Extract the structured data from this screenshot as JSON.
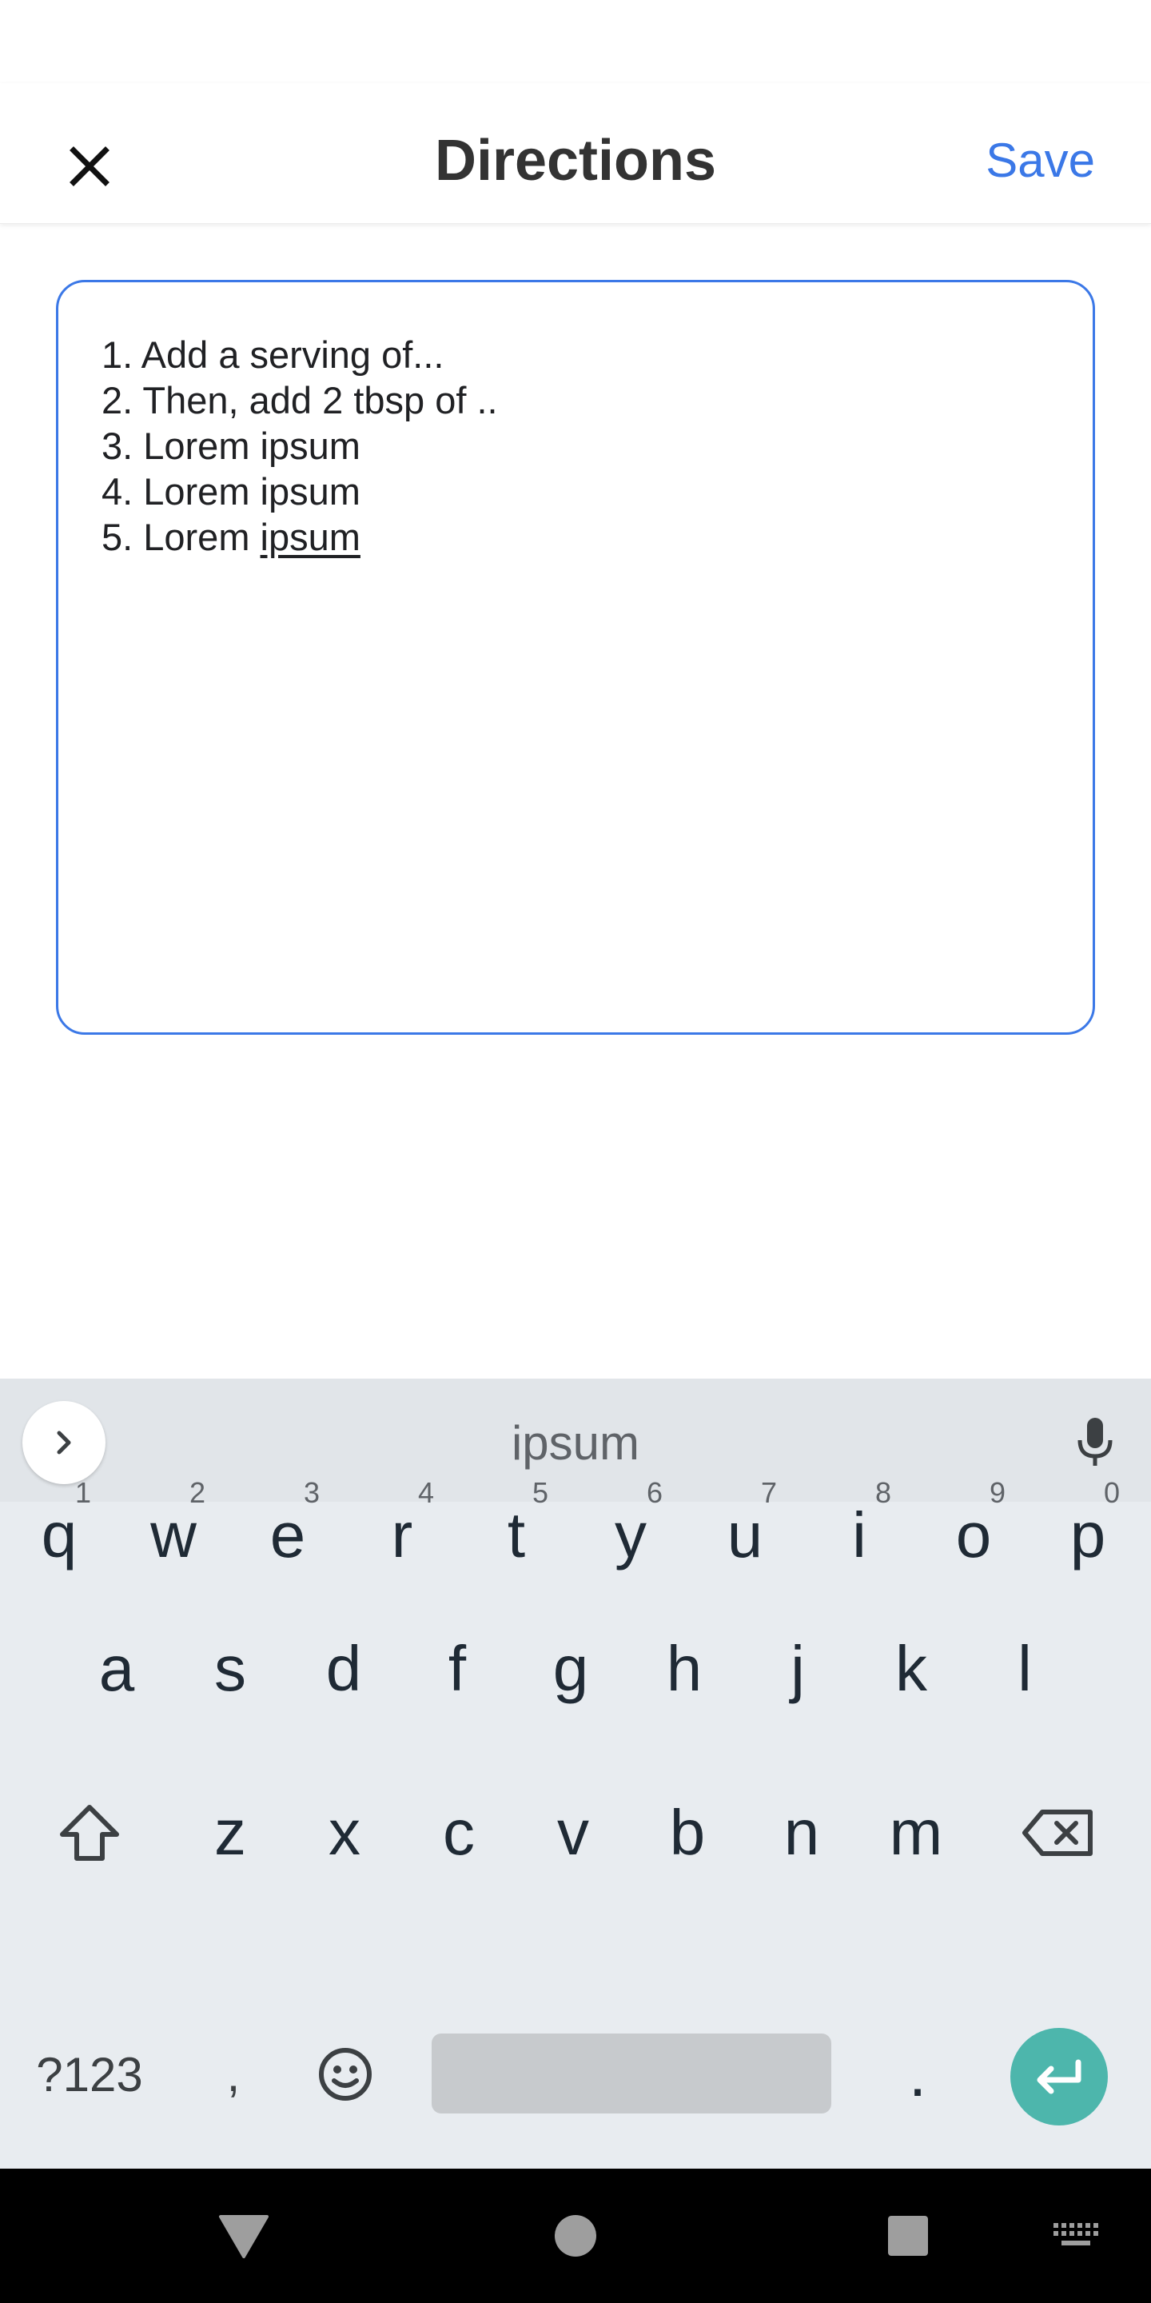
{
  "app_bar": {
    "title": "Directions",
    "save_label": "Save",
    "close_icon": "close-icon"
  },
  "editor": {
    "lines": [
      "1. Add a serving of...",
      "2. Then, add 2 tbsp of ..",
      "3. Lorem ipsum",
      "4. Lorem ipsum"
    ],
    "last_line_prefix": "5. Lorem ",
    "last_line_word": "ipsum",
    "border_color": "#3b78e7"
  },
  "keyboard": {
    "suggestion": "ipsum",
    "row1": [
      {
        "key": "q",
        "hint": "1"
      },
      {
        "key": "w",
        "hint": "2"
      },
      {
        "key": "e",
        "hint": "3"
      },
      {
        "key": "r",
        "hint": "4"
      },
      {
        "key": "t",
        "hint": "5"
      },
      {
        "key": "y",
        "hint": "6"
      },
      {
        "key": "u",
        "hint": "7"
      },
      {
        "key": "i",
        "hint": "8"
      },
      {
        "key": "o",
        "hint": "9"
      },
      {
        "key": "p",
        "hint": "0"
      }
    ],
    "row2": [
      "a",
      "s",
      "d",
      "f",
      "g",
      "h",
      "j",
      "k",
      "l"
    ],
    "row3": [
      "z",
      "x",
      "c",
      "v",
      "b",
      "n",
      "m"
    ],
    "symbols_label": "?123",
    "comma_label": ",",
    "period_label": ".",
    "enter_color": "#4db6ac"
  },
  "colors": {
    "accent": "#3b78e7",
    "keyboard_bg": "#e8ecf0"
  }
}
